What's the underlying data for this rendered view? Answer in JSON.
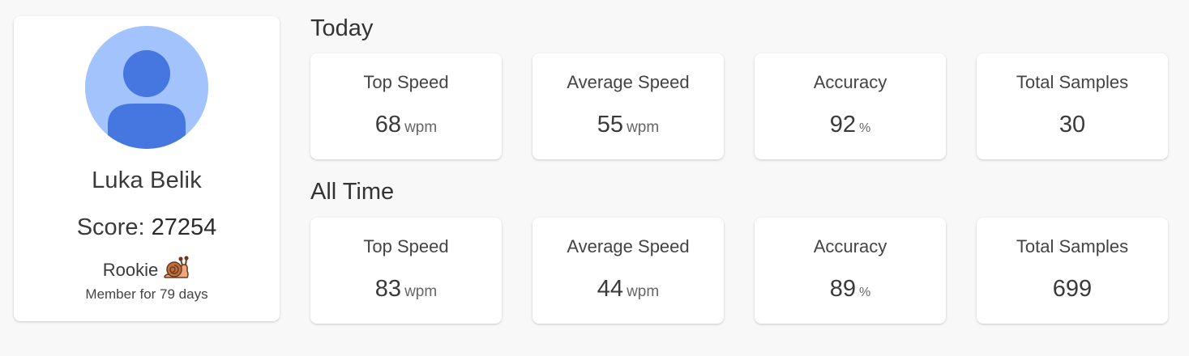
{
  "profile": {
    "name": "Luka Belik",
    "score_label": "Score:",
    "score_value": "27254",
    "rank": "Rookie",
    "rank_icon": "snail-icon",
    "member_text": "Member for 79 days",
    "avatar_icon": "user-avatar-icon",
    "colors": {
      "avatar_bg": "#a2c3fc",
      "avatar_fg": "#4676e0"
    }
  },
  "today": {
    "title": "Today",
    "stats": [
      {
        "label": "Top Speed",
        "value": "68",
        "unit": "wpm"
      },
      {
        "label": "Average Speed",
        "value": "55",
        "unit": "wpm"
      },
      {
        "label": "Accuracy",
        "value": "92",
        "unit": "%"
      },
      {
        "label": "Total Samples",
        "value": "30",
        "unit": ""
      }
    ]
  },
  "all_time": {
    "title": "All Time",
    "stats": [
      {
        "label": "Top Speed",
        "value": "83",
        "unit": "wpm"
      },
      {
        "label": "Average Speed",
        "value": "44",
        "unit": "wpm"
      },
      {
        "label": "Accuracy",
        "value": "89",
        "unit": "%"
      },
      {
        "label": "Total Samples",
        "value": "699",
        "unit": ""
      }
    ]
  }
}
